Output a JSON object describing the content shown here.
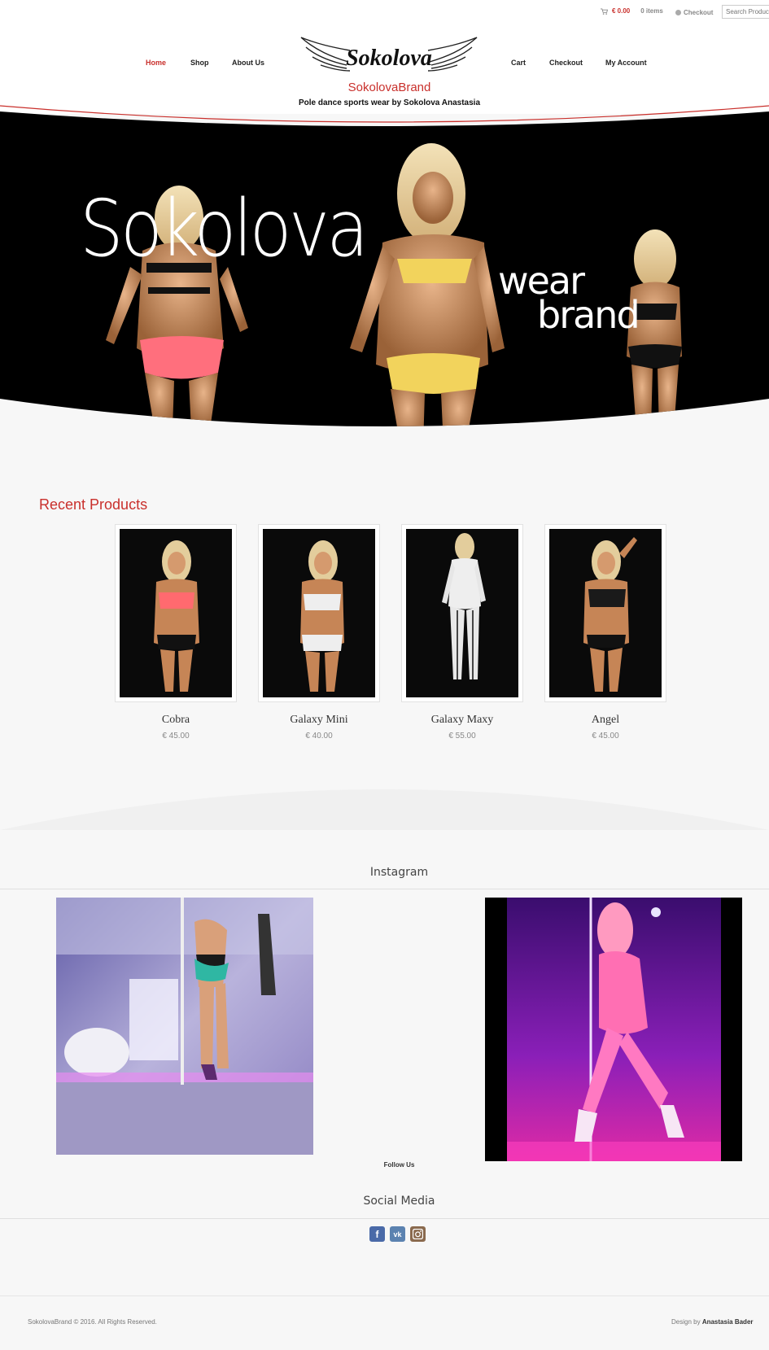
{
  "topbar": {
    "cart_total": "€ 0.00",
    "cart_items": "0 items",
    "checkout_label": "Checkout",
    "search_placeholder": "Search Products..."
  },
  "nav": {
    "left": [
      "Home",
      "Shop",
      "About Us"
    ],
    "right": [
      "Cart",
      "Checkout",
      "My Account"
    ],
    "active": "Home"
  },
  "logo": {
    "text": "Sokolova"
  },
  "site": {
    "title": "SokolovaBrand",
    "tagline": "Pole dance sports wear by Sokolova Anastasia"
  },
  "hero": {
    "line1": "Sokolova",
    "line2": "wear",
    "line3": "brand"
  },
  "recent": {
    "title": "Recent Products",
    "products": [
      {
        "name": "Cobra",
        "price": "€ 45.00"
      },
      {
        "name": "Galaxy Mini",
        "price": "€ 40.00"
      },
      {
        "name": "Galaxy Maxy",
        "price": "€ 55.00"
      },
      {
        "name": "Angel",
        "price": "€ 45.00"
      }
    ]
  },
  "instagram": {
    "title": "Instagram",
    "follow_label": "Follow Us"
  },
  "social": {
    "title": "Social Media",
    "icons": [
      "facebook-icon",
      "vk-icon",
      "instagram-icon"
    ]
  },
  "footer": {
    "copyright": "SokolovaBrand © 2016. All Rights Reserved.",
    "design_prefix": "Design by",
    "designer": "Anastasia Bader"
  },
  "colors": {
    "accent": "#c9302c",
    "hero_bg": "#000000",
    "page_bg": "#f7f7f7"
  }
}
